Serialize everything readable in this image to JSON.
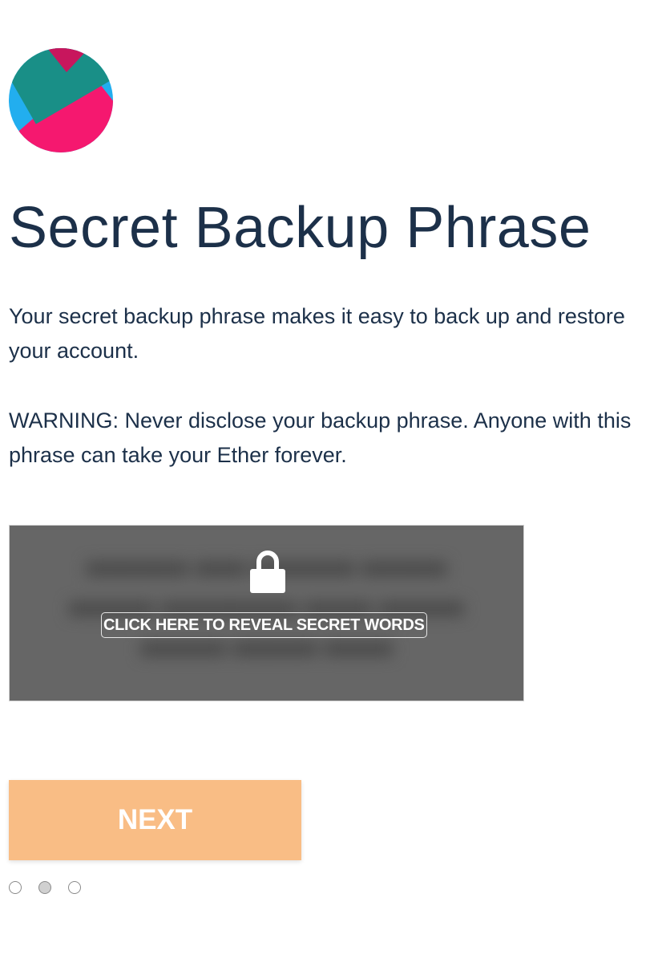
{
  "page": {
    "title": "Secret Backup Phrase",
    "intro": "Your secret backup phrase makes it easy to back up and restore your account.",
    "warning": "WARNING: Never disclose your backup phrase. Anyone with this phrase can take your Ether forever."
  },
  "reveal": {
    "label": "CLICK HERE TO REVEAL SECRET WORDS",
    "icon": "lock-icon"
  },
  "actions": {
    "next_label": "NEXT"
  },
  "pagination": {
    "total": 3,
    "active_index": 1
  },
  "colors": {
    "title": "#1c3049",
    "reveal_bg": "#666666",
    "next_bg": "#f9bd85",
    "avatar_pink": "#f5186f",
    "avatar_teal": "#198f87",
    "avatar_blue": "#22aeef",
    "avatar_crimson": "#c8165d"
  }
}
